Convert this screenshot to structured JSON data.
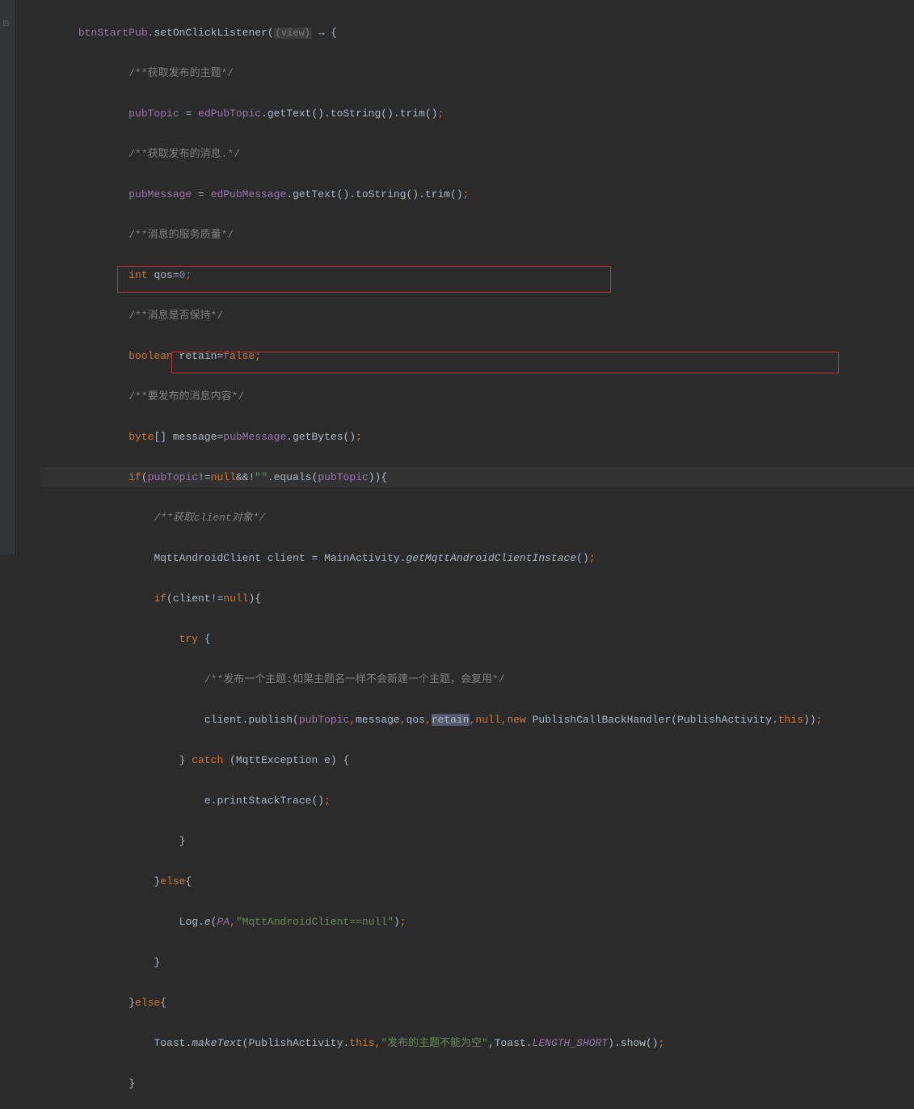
{
  "code": {
    "l1_obj": "btnStartPub",
    "l1_method": ".setOnClickListener(",
    "l1_hint": "(view)",
    "l1_arrow": " → {",
    "l2": "/**获取发布的主题*/",
    "l3_var": "pubTopic",
    "l3_eq": " = ",
    "l3_field": "edPubTopic",
    "l3_rest": ".getText().toString().trim()",
    "l3_semi": ";",
    "l4": "/**获取发布的消息.*/",
    "l5_var": "pubMessage",
    "l5_eq": " = ",
    "l5_field": "edPubMessage",
    "l5_rest": ".getText().toString().trim()",
    "l5_semi": ";",
    "l6": "/**消息的服务质量*/",
    "l7_kw": "int ",
    "l7_var": "qos=",
    "l7_num": "0",
    "l7_semi": ";",
    "l8": "/**消息是否保持*/",
    "l9_kw": "boolean ",
    "l9_var": "retain=",
    "l9_val": "false",
    "l9_semi": ";",
    "l10": "/**要发布的消息内容*/",
    "l11_kw": "byte",
    "l11_arr": "[] message=",
    "l11_field": "pubMessage",
    "l11_rest": ".getBytes()",
    "l11_semi": ";",
    "l12_if": "if",
    "l12_p1": "(",
    "l12_var1": "pubTopic",
    "l12_ne": "!=",
    "l12_null": "null",
    "l12_and": "&&!",
    "l12_str": "\"\"",
    "l12_eq": ".equals(",
    "l12_var2": "pubTopic",
    "l12_end": ")){",
    "l13_a": "/**获取",
    "l13_b": "client",
    "l13_c": "对象*/",
    "l14_type": "MqttAndroidClient client = MainActivity.",
    "l14_method": "getMqttAndroidClientInstace",
    "l14_end": "()",
    "l14_semi": ";",
    "l15_if": "if",
    "l15_cond": "(client!=",
    "l15_null": "null",
    "l15_end": "){",
    "l16_try": "try ",
    "l16_brace": "{",
    "l17": "/**发布一个主题:如果主题名一样不会新建一个主题，会复用*/",
    "l18_call": "client.publish(",
    "l18_arg1": "pubTopic",
    "l18_c1": ",",
    "l18_arg2": "message",
    "l18_c2": ",",
    "l18_arg3": "qos",
    "l18_c3": ",",
    "l18_arg4": "retain",
    "l18_c4": ",",
    "l18_null": "null",
    "l18_c5": ",",
    "l18_new": "new ",
    "l18_handler": "PublishCallBackHandler(PublishActivity.",
    "l18_this": "this",
    "l18_end": "))",
    "l18_semi": ";",
    "l19_brace": "} ",
    "l19_catch": "catch ",
    "l19_cond": "(MqttException e) {",
    "l20": "e.printStackTrace()",
    "l20_semi": ";",
    "l21": "}",
    "l22_brace": "}",
    "l22_else": "else",
    "l22_open": "{",
    "l23_log": "Log.",
    "l23_e": "e",
    "l23_p1": "(",
    "l23_pa": "PA",
    "l23_c": ",",
    "l23_str": "\"MqttAndroidClient==null\"",
    "l23_end": ")",
    "l23_semi": ";",
    "l24": "}",
    "l25_brace": "}",
    "l25_else": "else",
    "l25_open": "{",
    "l26_toast": "Toast.",
    "l26_make": "makeText",
    "l26_p1": "(PublishActivity.",
    "l26_this": "this",
    "l26_c1": ",",
    "l26_str": "\"发布的主题不能为空\"",
    "l26_c2": ",Toast.",
    "l26_len": "LENGTH_SHORT",
    "l26_end": ").show()",
    "l26_semi": ";",
    "l27": "}"
  }
}
